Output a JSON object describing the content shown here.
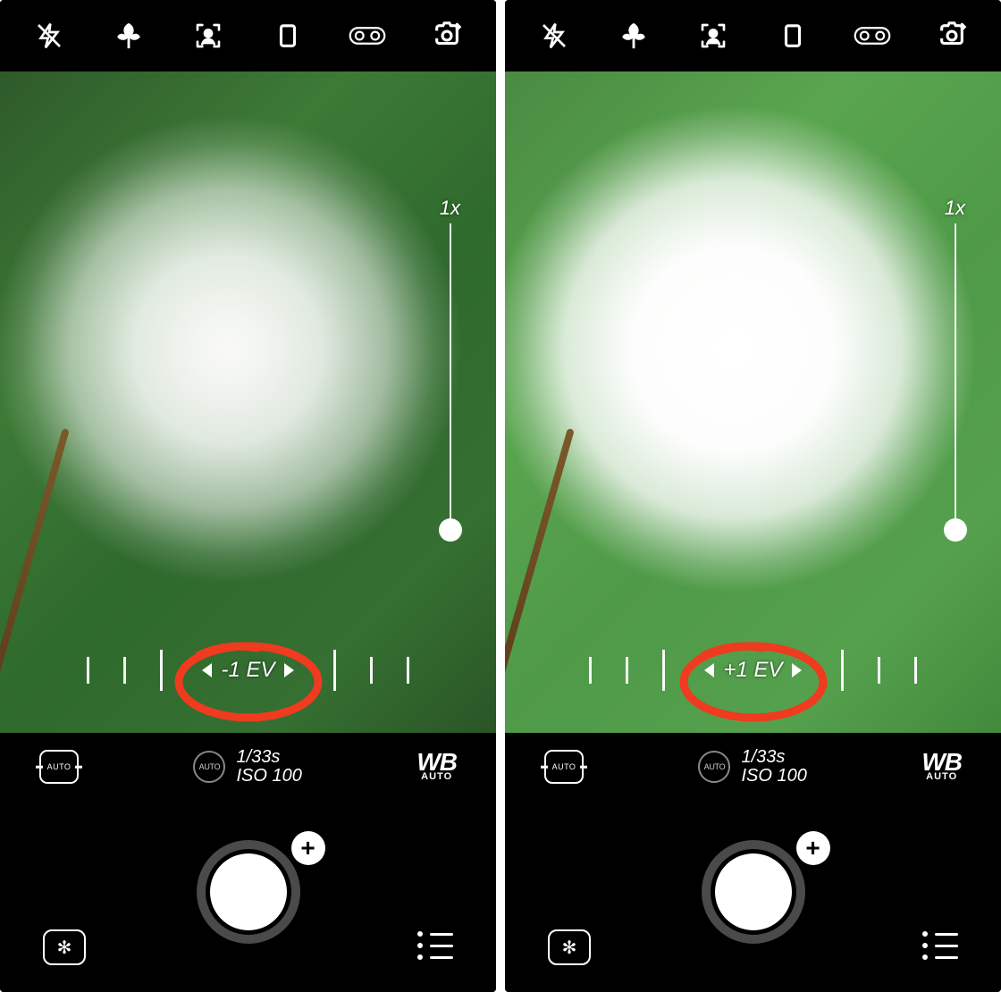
{
  "screens": [
    {
      "zoom_label": "1x",
      "ev_value": "-1 EV",
      "settings": {
        "focus_mode": "AUTO",
        "metering": "AUTO",
        "shutter": "1/33s",
        "iso": "ISO 100",
        "wb": "WB",
        "wb_mode": "AUTO"
      }
    },
    {
      "zoom_label": "1x",
      "ev_value": "+1 EV",
      "settings": {
        "focus_mode": "AUTO",
        "metering": "AUTO",
        "shutter": "1/33s",
        "iso": "ISO 100",
        "wb": "WB",
        "wb_mode": "AUTO"
      }
    }
  ],
  "plus_label": "+"
}
